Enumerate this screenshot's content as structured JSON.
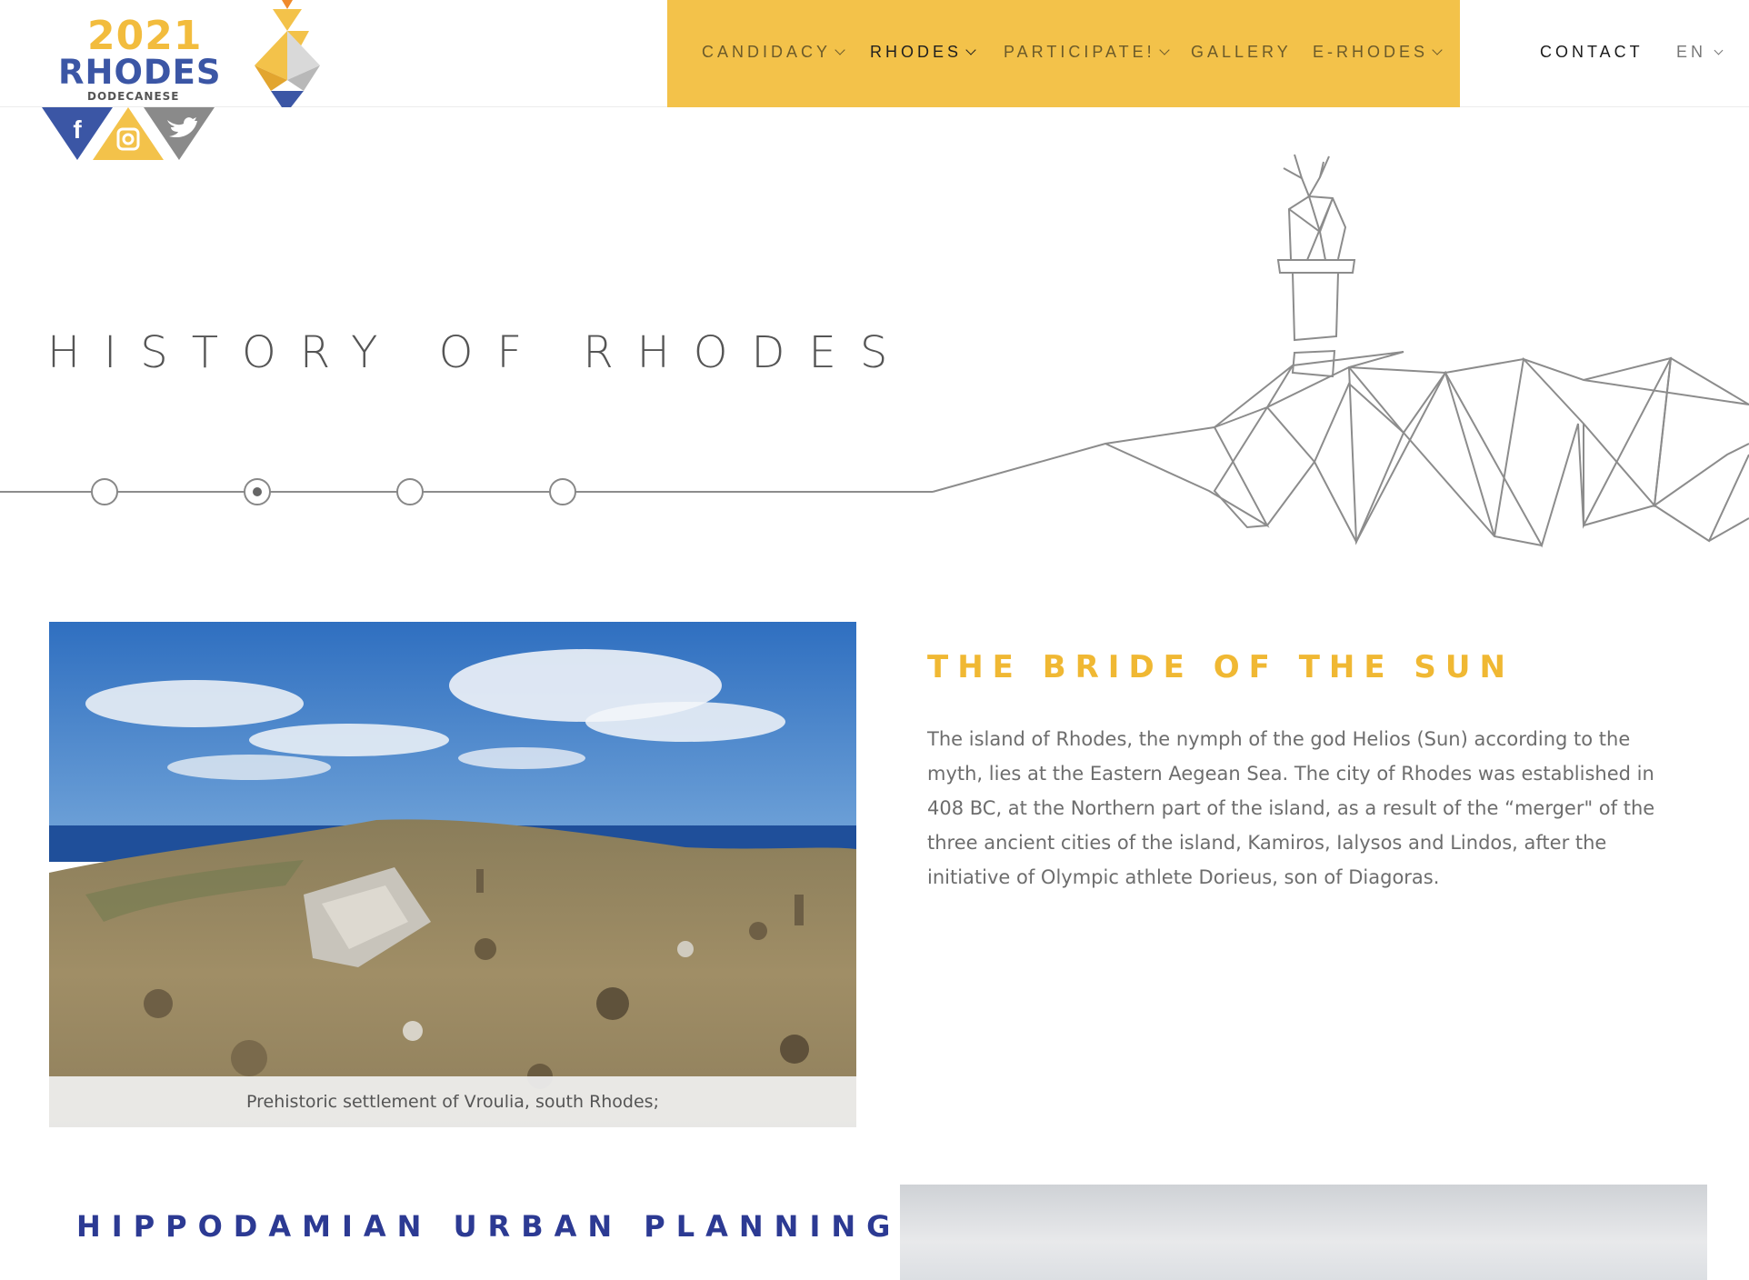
{
  "logo": {
    "year": "2021",
    "name": "RHODES",
    "subtitle": "DODECANESE"
  },
  "social": [
    {
      "name": "facebook-icon",
      "color": "#3b56a5"
    },
    {
      "name": "instagram-icon",
      "color": "#f3c24a"
    },
    {
      "name": "twitter-icon",
      "color": "#8a8a8a"
    }
  ],
  "nav": {
    "background": "#f3c24a",
    "items": [
      {
        "label": "CANDIDACY",
        "has_dropdown": true,
        "active": false
      },
      {
        "label": "RHODES",
        "has_dropdown": true,
        "active": true
      },
      {
        "label": "PARTICIPATE!",
        "has_dropdown": true,
        "active": false
      },
      {
        "label": "GALLERY",
        "has_dropdown": false,
        "active": false
      },
      {
        "label": "E-RHODES",
        "has_dropdown": true,
        "active": false
      }
    ],
    "contact": "CONTACT",
    "language": "EN"
  },
  "hero": {
    "title": "HISTORY OF RHODES",
    "timeline_steps": 4,
    "timeline_active_index": 1
  },
  "section1": {
    "title": "THE BRIDE OF THE SUN",
    "body": "The island of Rhodes, the nymph of the god Helios (Sun) according to the myth, lies at the Eastern Aegean Sea. The city of Rhodes was established in 408 BC, at the Northern part of the island, as a result of the “merger\" of the three ancient cities of the island, Kamiros, Ialysos and Lindos, after the initiative of Olympic athlete Dorieus, son of Diagoras.",
    "photo_caption": "Prehistoric settlement of Vroulia, south Rhodes;"
  },
  "section2": {
    "title": "HIPPODAMIAN URBAN PLANNING SYSTEM"
  },
  "colors": {
    "accent_yellow": "#f0b833",
    "brand_blue": "#2c3a93",
    "text_gray": "#6d6d6d"
  }
}
